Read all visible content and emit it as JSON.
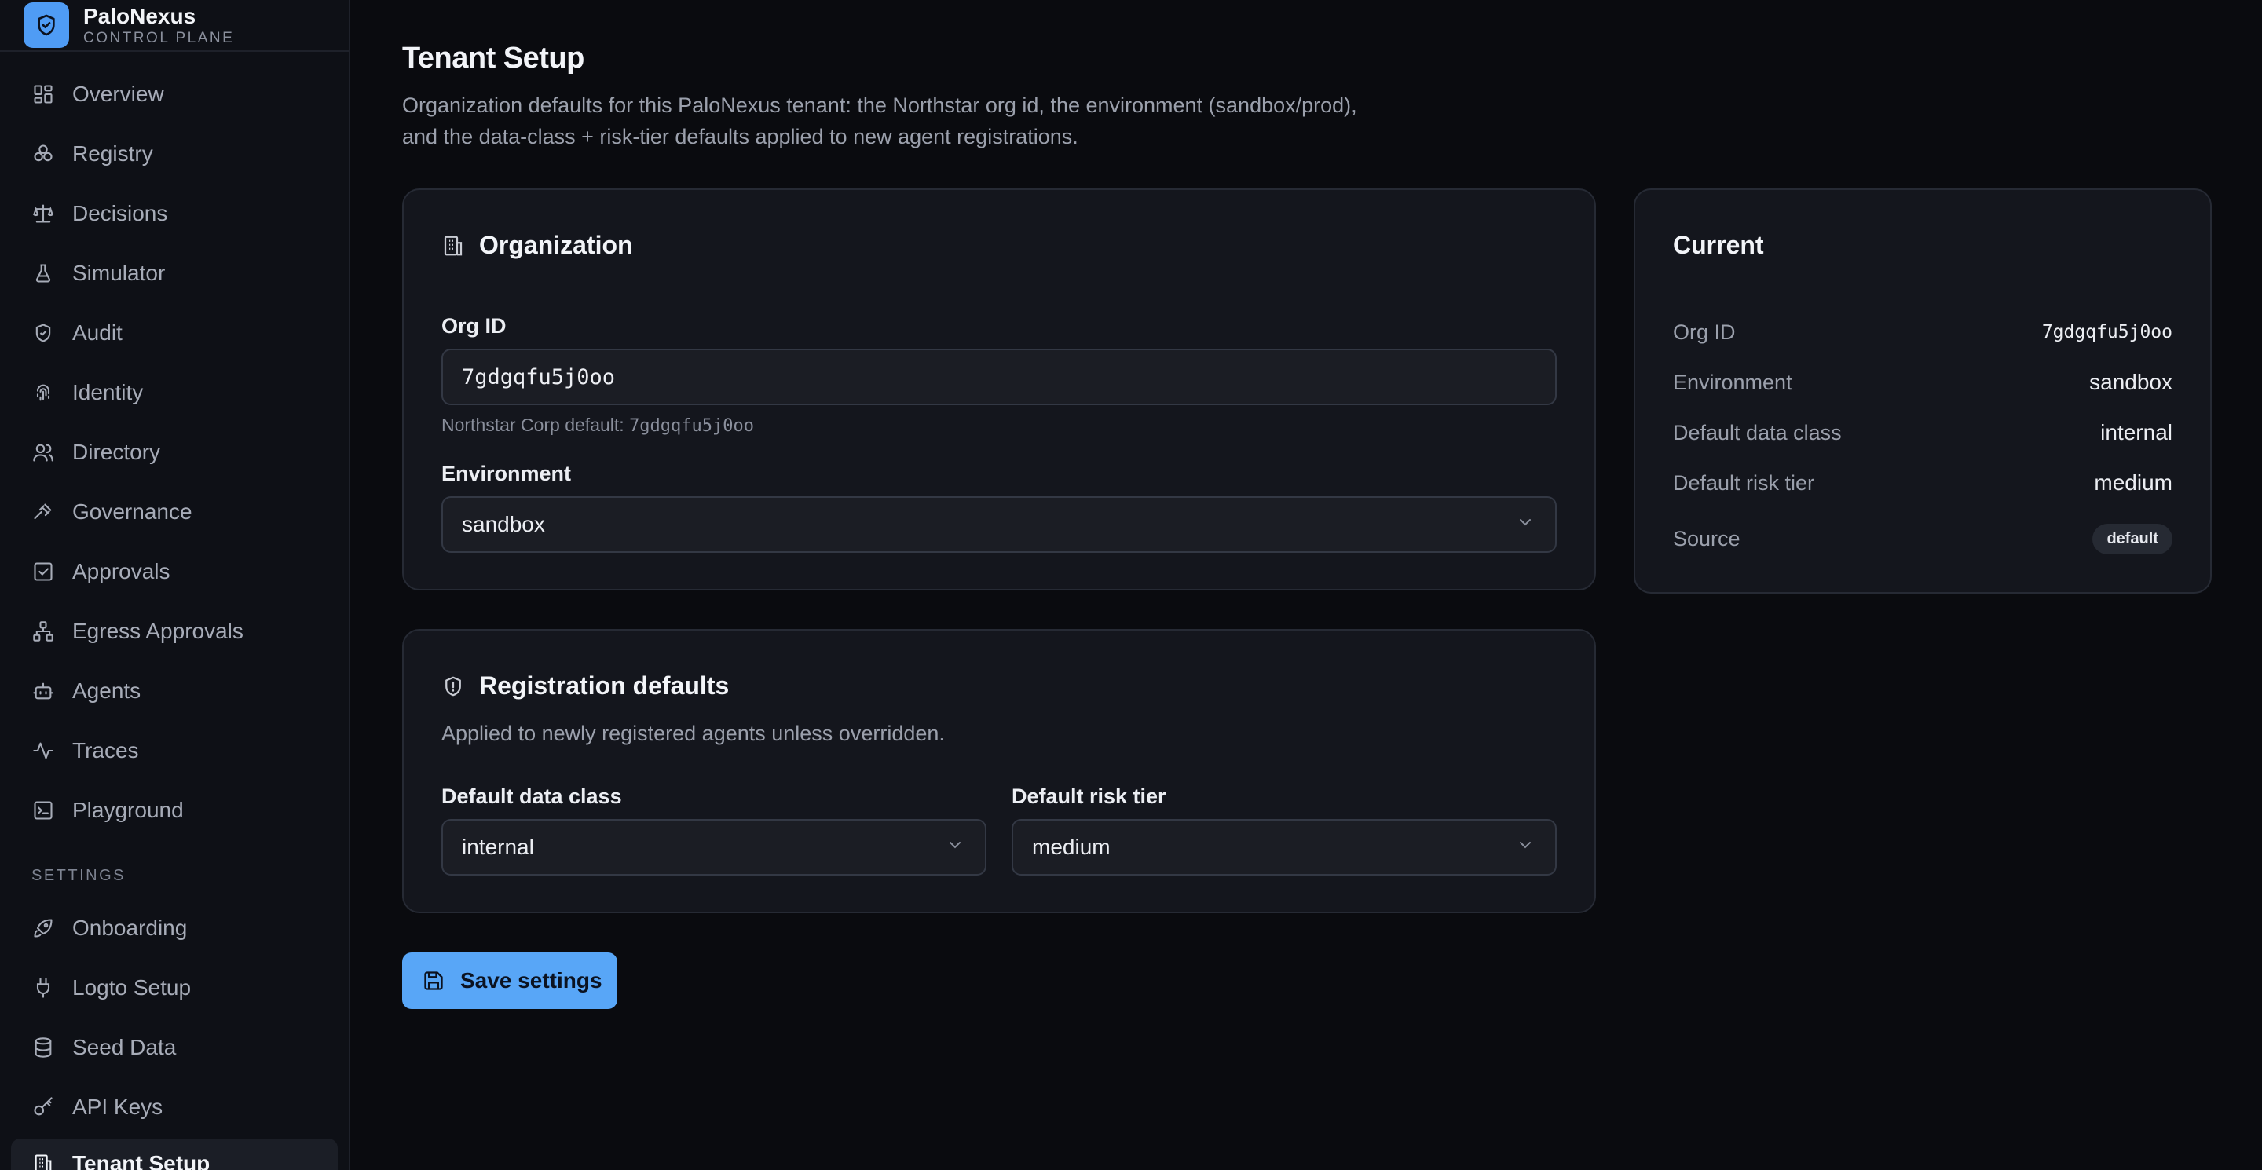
{
  "brand": {
    "name": "PaloNexus",
    "subtitle": "CONTROL PLANE"
  },
  "sidebar": {
    "items": [
      {
        "label": "Overview",
        "icon": "dashboard-icon"
      },
      {
        "label": "Registry",
        "icon": "boxes-icon"
      },
      {
        "label": "Decisions",
        "icon": "scale-icon"
      },
      {
        "label": "Simulator",
        "icon": "flask-icon"
      },
      {
        "label": "Audit",
        "icon": "shield-check-icon"
      },
      {
        "label": "Identity",
        "icon": "fingerprint-icon"
      },
      {
        "label": "Directory",
        "icon": "users-icon"
      },
      {
        "label": "Governance",
        "icon": "gavel-icon"
      },
      {
        "label": "Approvals",
        "icon": "checkbox-icon"
      },
      {
        "label": "Egress Approvals",
        "icon": "network-icon"
      },
      {
        "label": "Agents",
        "icon": "bot-icon"
      },
      {
        "label": "Traces",
        "icon": "activity-icon"
      },
      {
        "label": "Playground",
        "icon": "terminal-icon"
      }
    ],
    "settings_label": "SETTINGS",
    "settings_items": [
      {
        "label": "Onboarding",
        "icon": "rocket-icon"
      },
      {
        "label": "Logto Setup",
        "icon": "plug-icon"
      },
      {
        "label": "Seed Data",
        "icon": "database-icon"
      },
      {
        "label": "API Keys",
        "icon": "key-icon"
      },
      {
        "label": "Tenant Setup",
        "icon": "building-icon",
        "active": true
      }
    ]
  },
  "header": {
    "title": "Tenant Setup",
    "description_line1": "Organization defaults for this PaloNexus tenant: the Northstar org id, the environment (sandbox/prod),",
    "description_line2": "and the data-class + risk-tier defaults applied to new agent registrations."
  },
  "organization": {
    "title": "Organization",
    "org_id_label": "Org ID",
    "org_id_value": "7gdgqfu5j0oo",
    "hint_prefix": "Northstar Corp default:",
    "hint_value": "7gdgqfu5j0oo",
    "environment_label": "Environment",
    "environment_value": "sandbox"
  },
  "registration": {
    "title": "Registration defaults",
    "subtitle": "Applied to newly registered agents unless overridden.",
    "data_class_label": "Default data class",
    "data_class_value": "internal",
    "risk_tier_label": "Default risk tier",
    "risk_tier_value": "medium"
  },
  "current": {
    "title": "Current",
    "rows": [
      {
        "key": "Org ID",
        "value": "7gdgqfu5j0oo"
      },
      {
        "key": "Environment",
        "value": "sandbox"
      },
      {
        "key": "Default data class",
        "value": "internal"
      },
      {
        "key": "Default risk tier",
        "value": "medium"
      },
      {
        "key": "Source",
        "value": "default"
      }
    ]
  },
  "actions": {
    "save_label": "Save settings"
  },
  "colors": {
    "accent": "#58a6f7",
    "background": "#0a0b0f",
    "card": "#14161d"
  }
}
